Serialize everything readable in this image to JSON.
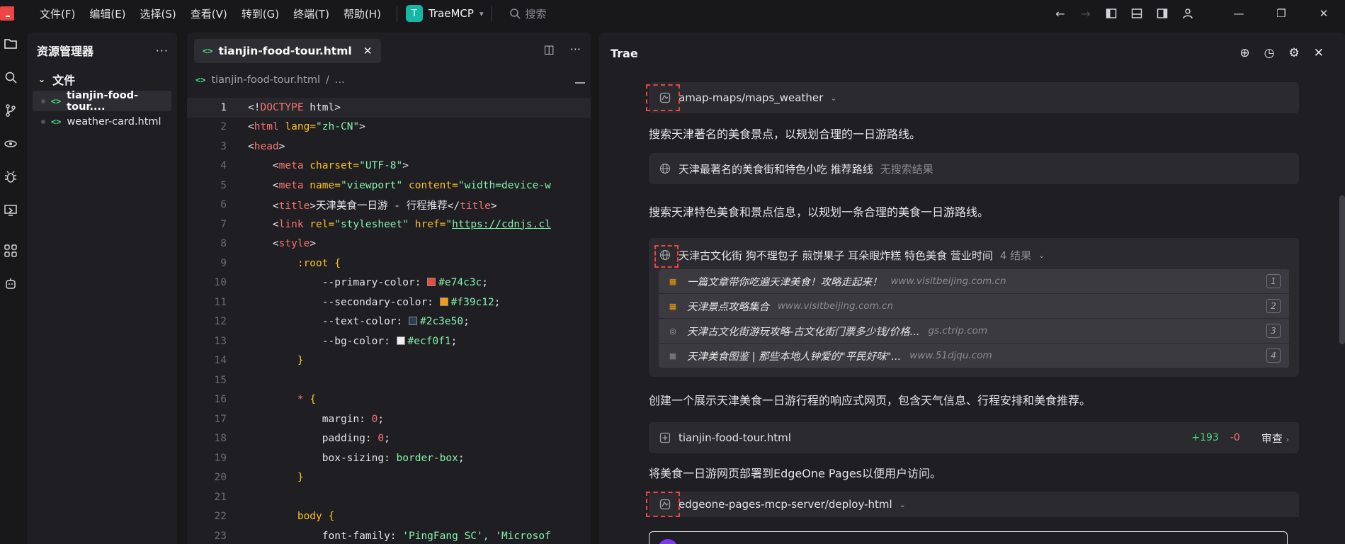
{
  "menu": [
    "文件(F)",
    "编辑(E)",
    "选择(S)",
    "查看(V)",
    "转到(G)",
    "终端(T)",
    "帮助(H)"
  ],
  "project": {
    "badge": "T",
    "name": "TraeMCP"
  },
  "search_label": "搜索",
  "explorer": {
    "title": "资源管理器",
    "section": "文件",
    "files": [
      "tianjin-food-tour....",
      "weather-card.html"
    ]
  },
  "editor": {
    "tab": "tianjin-food-tour.html",
    "breadcrumb": [
      "tianjin-food-tour.html",
      "..."
    ],
    "line_numbers": [
      "1",
      "2",
      "3",
      "4",
      "5",
      "6",
      "7",
      "8",
      "9",
      "10",
      "11",
      "12",
      "13",
      "14",
      "15",
      "16",
      "17",
      "18",
      "19",
      "20",
      "21",
      "22",
      "23"
    ],
    "code": {
      "l1a": "<!",
      "l1b": "DOCTYPE",
      "l1c": " html>",
      "l2a": "<",
      "l2b": "html",
      "l2c": " lang=",
      "l2d": "\"zh-CN\"",
      "l2e": ">",
      "l3a": "<",
      "l3b": "head",
      "l3c": ">",
      "l4a": "<",
      "l4b": "meta",
      "l4c": " charset=",
      "l4d": "\"UTF-8\"",
      "l4e": ">",
      "l5a": "<",
      "l5b": "meta",
      "l5c": " name=",
      "l5d": "\"viewport\"",
      "l5e": " content=",
      "l5f": "\"width=device-w",
      "l6a": "<",
      "l6b": "title",
      "l6c": ">天津美食一日游 - 行程推荐</",
      "l6d": "title",
      "l6e": ">",
      "l7a": "<",
      "l7b": "link",
      "l7c": " rel=",
      "l7d": "\"stylesheet\"",
      "l7e": " href=",
      "l7f": "\"",
      "l7g": "https://cdnjs.cl",
      "l8a": "<",
      "l8b": "style",
      "l8c": ">",
      "l9a": ":root ",
      "l9b": "{",
      "l10a": "--primary-color: ",
      "l10b": "#e74c3c",
      "l10c": ";",
      "l11a": "--secondary-color: ",
      "l11b": "#f39c12",
      "l11c": ";",
      "l12a": "--text-color: ",
      "l12b": "#2c3e50",
      "l12c": ";",
      "l13a": "--bg-color: ",
      "l13b": "#ecf0f1",
      "l13c": ";",
      "l14": "}",
      "l16a": "* ",
      "l16b": "{",
      "l17a": "margin: ",
      "l17b": "0",
      "l17c": ";",
      "l18a": "padding: ",
      "l18b": "0",
      "l18c": ";",
      "l19a": "box-sizing: ",
      "l19b": "border-box",
      "l19c": ";",
      "l20": "}",
      "l22a": "body ",
      "l22b": "{",
      "l23a": "font-family: ",
      "l23b": "'PingFang SC', 'Microsof"
    }
  },
  "colors": {
    "primary": "#e74c3c",
    "secondary": "#f39c12",
    "text": "#2c3e50",
    "bg": "#ecf0f1"
  },
  "chat": {
    "title": "Trae",
    "tool1": "amap-maps/maps_weather",
    "msg1": "搜索天津著名的美食景点，以规划合理的一日游路线。",
    "search1": {
      "query": "天津最著名的美食街和特色小吃 推荐路线",
      "status": "无搜索结果"
    },
    "msg2": "搜索天津特色美食和景点信息，以规划一条合理的美食一日游路线。",
    "search2": {
      "query": "天津古文化街 狗不理包子 煎饼果子 耳朵眼炸糕 特色美食 营业时间",
      "status": "4 结果"
    },
    "results": [
      {
        "title": "一篇文章带你吃遍天津美食！攻略走起来！",
        "site": "www.visitbeijing.com.cn",
        "num": "1"
      },
      {
        "title": "天津景点攻略集合",
        "site": "www.visitbeijing.com.cn",
        "num": "2"
      },
      {
        "title": "天津古文化街游玩攻略-古文化街门票多少钱/价格...",
        "site": "gs.ctrip.com",
        "num": "3"
      },
      {
        "title": "天津美食图鉴 | 那些本地人钟爱的\"平民好味\"...",
        "site": "www.51djqu.com",
        "num": "4"
      }
    ],
    "msg3": "创建一个展示天津美食一日游行程的响应式网页，包含天气信息、行程安排和美食推荐。",
    "file": {
      "name": "tianjin-food-tour.html",
      "added": "+193",
      "removed": "-0",
      "review": "审查"
    },
    "msg4": "将美食一日游网页部署到EdgeOne Pages以便用户访问。",
    "tool2": "edgeone-pages-mcp-server/deploy-html"
  }
}
